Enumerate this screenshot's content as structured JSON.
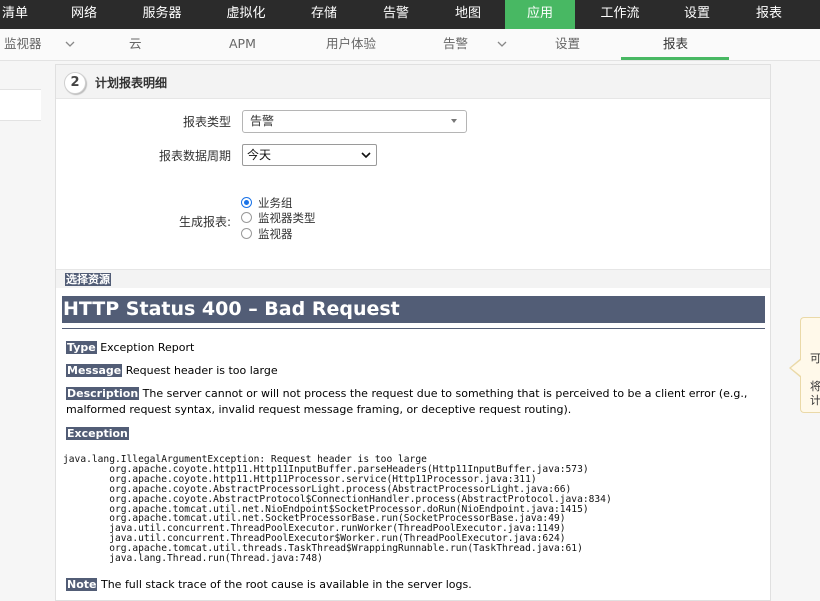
{
  "topnav": {
    "items": [
      "清单",
      "网络",
      "服务器",
      "虚拟化",
      "存储",
      "告警",
      "地图",
      "应用",
      "工作流",
      "设置",
      "报表"
    ],
    "active": "应用"
  },
  "subnav": {
    "items": [
      "监视器",
      "云",
      "APM",
      "用户体验",
      "告警",
      "设置",
      "报表"
    ],
    "active": "报表"
  },
  "section": {
    "step": "2",
    "title": "计划报表明细"
  },
  "form": {
    "report_type_label": "报表类型",
    "report_type_value": "告警",
    "period_label": "报表数据周期",
    "period_value": "今天",
    "generate_label": "生成报表:",
    "generate_options": [
      "业务组",
      "监视器类型",
      "监视器"
    ],
    "generate_selected": "业务组"
  },
  "choose_resources": "选择资源",
  "error": {
    "title": "HTTP Status 400 – Bad Request",
    "type_label": "Type",
    "type_text": "Exception Report",
    "message_label": "Message",
    "message_text": "Request header is too large",
    "description_label": "Description",
    "description_text": "The server cannot or will not process the request due to something that is perceived to be a client error (e.g., malformed request syntax, invalid request message framing, or deceptive request routing).",
    "exception_label": "Exception",
    "stack_trace": "java.lang.IllegalArgumentException: Request header is too large\n\torg.apache.coyote.http11.Http11InputBuffer.parseHeaders(Http11InputBuffer.java:573)\n\torg.apache.coyote.http11.Http11Processor.service(Http11Processor.java:311)\n\torg.apache.coyote.AbstractProcessorLight.process(AbstractProcessorLight.java:66)\n\torg.apache.coyote.AbstractProtocol$ConnectionHandler.process(AbstractProtocol.java:834)\n\torg.apache.tomcat.util.net.NioEndpoint$SocketProcessor.doRun(NioEndpoint.java:1415)\n\torg.apache.tomcat.util.net.SocketProcessorBase.run(SocketProcessorBase.java:49)\n\tjava.util.concurrent.ThreadPoolExecutor.runWorker(ThreadPoolExecutor.java:1149)\n\tjava.util.concurrent.ThreadPoolExecutor$Worker.run(ThreadPoolExecutor.java:624)\n\torg.apache.tomcat.util.threads.TaskThread$WrappingRunnable.run(TaskThread.java:61)\n\tjava.lang.Thread.run(Thread.java:748)",
    "note_label": "Note",
    "note_text": "The full stack trace of the root cause is available in the server logs."
  },
  "side_tip": {
    "line1": "可",
    "line2": "将",
    "line3": "计"
  },
  "colors": {
    "accent": "#48b863",
    "nav_bg": "#2b2b2b",
    "error_bar": "#525d76"
  }
}
